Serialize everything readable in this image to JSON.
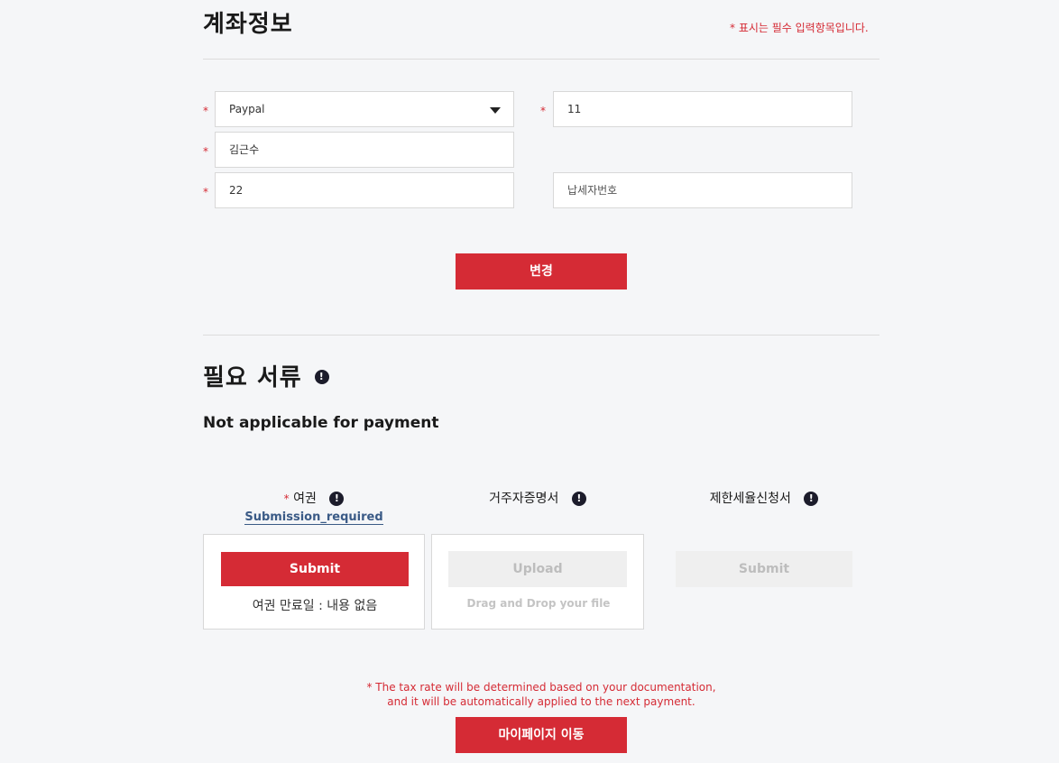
{
  "account": {
    "title": "계좌정보",
    "required_note": "* 표시는 필수 입력항목입니다.",
    "required_mark": "*",
    "payment_method": "Paypal",
    "account_number": "11",
    "holder_name": "김근수",
    "field_value_22": "22",
    "tax_id_placeholder": "납세자번호",
    "change_button": "변경"
  },
  "documents": {
    "title": "필요 서류",
    "info_glyph": "!",
    "subtitle": "Not applicable for payment",
    "passport": {
      "label": "여권",
      "status_link": "Submission_required",
      "submit_button": "Submit",
      "expiry_text": "여권 만료일 : 내용 없음"
    },
    "residence": {
      "label": "거주자증명서",
      "upload_button": "Upload",
      "drop_hint": "Drag and Drop your file"
    },
    "tax_form": {
      "label": "제한세율신청서",
      "submit_button": "Submit"
    }
  },
  "footer": {
    "note_line1": "* The tax rate will be determined based on your documentation,",
    "note_line2": "and it will be automatically applied to the next payment.",
    "mypage_button": "마이페이지 이동"
  },
  "colors": {
    "accent": "#d52b35",
    "background": "#f5f6f8",
    "link": "#3a5a86"
  }
}
